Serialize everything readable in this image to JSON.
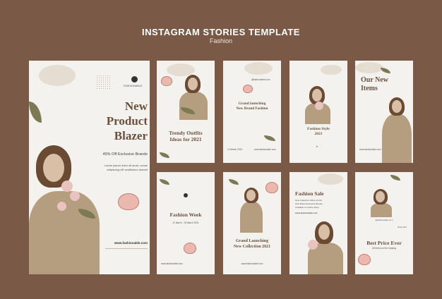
{
  "header": {
    "title": "INSTAGRAM STORIES TEMPLATE",
    "subtitle": "Fashion"
  },
  "main_story": {
    "brand": "FASHIONABLE",
    "headline_1": "New",
    "headline_2": "Product",
    "headline_3": "Blazer",
    "offer": "45% Off Exclusive Brands",
    "body_1": "Lorem ipsum dolor sit amet, conse",
    "body_2": "adipiscing elit vestibulum laoreet",
    "website": "www.fashionable.com"
  },
  "stories": [
    {
      "headline_1": "Trendy Outfits",
      "headline_2": "Ideas for 2021"
    },
    {
      "handle": "@fashionable.com",
      "headline_1": "Grand launching",
      "headline_2": "New Brand Fashion",
      "date": "12 March 2021",
      "website": "www.fashionable.com"
    },
    {
      "headline_1": "Fashion Style",
      "headline_2": "2021"
    },
    {
      "headline_1": "Our New",
      "headline_2": "Items",
      "website": "www.fashionable.com"
    },
    {
      "headline": "Fashion Week",
      "dates": "12 March - 18 March 2021",
      "website": "www.fashionable.com"
    },
    {
      "headline_1": "Grand Launching",
      "headline_2": "New Collection 2021",
      "website": "www.fashionable.com"
    },
    {
      "headline": "Fashion Sale",
      "line_1": "New Collection Otline Arrival",
      "line_2": "New Brand Exclusive Brands",
      "line_3": "Available on Online Store",
      "website": "www.fashionable.com"
    },
    {
      "handle": "@fashionable.com",
      "only": "Only 21st",
      "headline": "Best Price Ever",
      "line": "All Items on the Catalog"
    }
  ]
}
